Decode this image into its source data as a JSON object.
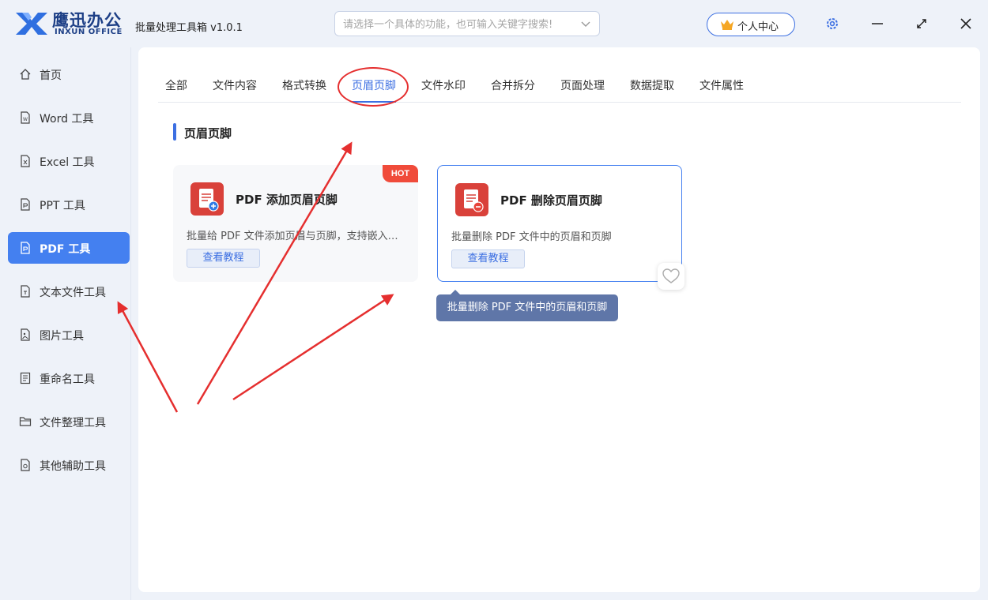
{
  "brand": {
    "name_cn": "鹰迅办公",
    "name_en": "INXUN OFFICE"
  },
  "app_title": "批量处理工具箱 v1.0.1",
  "search": {
    "placeholder": "请选择一个具体的功能，也可输入关键字搜索!"
  },
  "user_center": "个人中心",
  "sidebar": {
    "items": [
      {
        "label": "首页",
        "icon": "home-icon"
      },
      {
        "label": "Word 工具",
        "icon": "word-file-icon"
      },
      {
        "label": "Excel 工具",
        "icon": "excel-file-icon"
      },
      {
        "label": "PPT 工具",
        "icon": "ppt-file-icon"
      },
      {
        "label": "PDF 工具",
        "icon": "pdf-file-icon",
        "active": true
      },
      {
        "label": "文本文件工具",
        "icon": "text-file-icon"
      },
      {
        "label": "图片工具",
        "icon": "image-file-icon"
      },
      {
        "label": "重命名工具",
        "icon": "rename-icon"
      },
      {
        "label": "文件整理工具",
        "icon": "folder-icon"
      },
      {
        "label": "其他辅助工具",
        "icon": "tools-icon"
      }
    ]
  },
  "tabs": [
    {
      "label": "全部"
    },
    {
      "label": "文件内容"
    },
    {
      "label": "格式转换"
    },
    {
      "label": "页眉页脚",
      "active": true
    },
    {
      "label": "文件水印"
    },
    {
      "label": "合并拆分"
    },
    {
      "label": "页面处理"
    },
    {
      "label": "数据提取"
    },
    {
      "label": "文件属性"
    }
  ],
  "section_title": "页眉页脚",
  "cards": [
    {
      "title": "PDF 添加页眉页脚",
      "desc": "批量给 PDF 文件添加页眉与页脚，支持嵌入文字、图片",
      "tutorial": "查看教程",
      "badge": "HOT",
      "icon": "pdf-add-icon"
    },
    {
      "title": "PDF 删除页眉页脚",
      "desc": "批量删除 PDF 文件中的页眉和页脚",
      "tutorial": "查看教程",
      "icon": "pdf-remove-icon",
      "selected": true
    }
  ],
  "tooltip": "批量删除 PDF 文件中的页眉和页脚",
  "colors": {
    "accent": "#3c6fe2",
    "sidebar_active": "#4480f0",
    "hot": "#f04b3a",
    "annotation_red": "#e52f2f",
    "pdf_red": "#d9413a"
  }
}
